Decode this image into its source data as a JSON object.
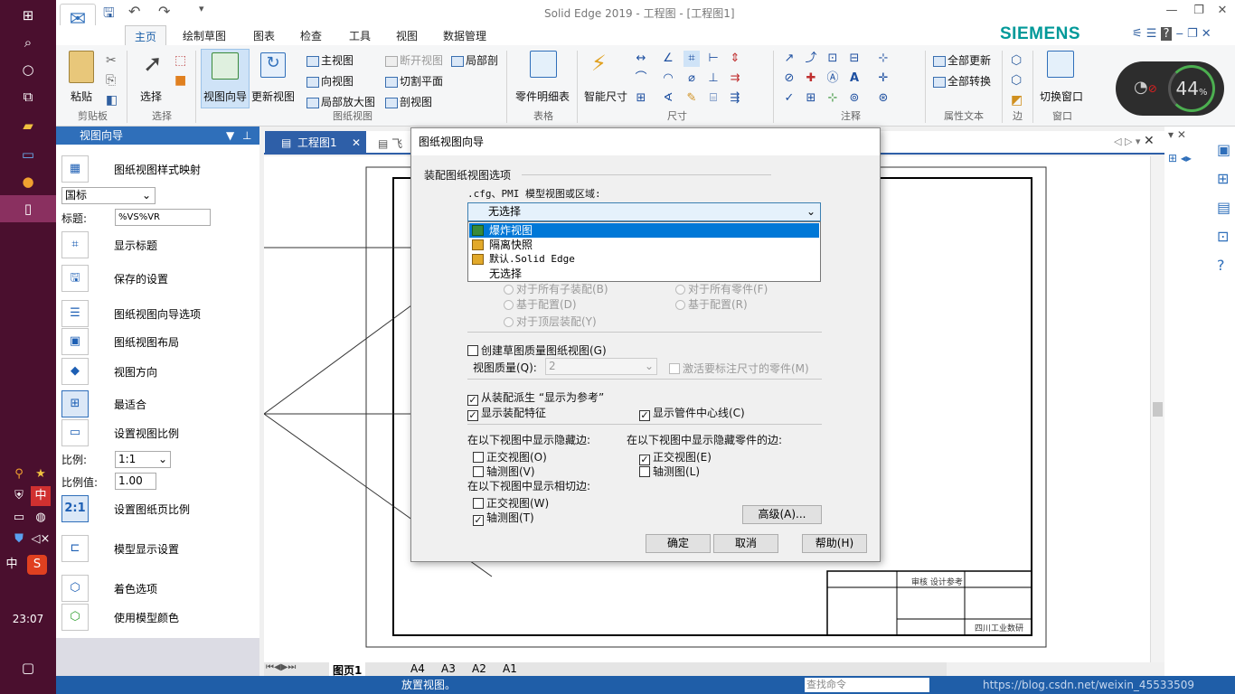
{
  "window": {
    "title": "Solid Edge 2019 - 工程图 - [工程图1]",
    "brand": "SIEMENS"
  },
  "ribbon_tabs": [
    "主页",
    "绘制草图",
    "图表",
    "检查",
    "工具",
    "视图",
    "数据管理"
  ],
  "ribbon": {
    "paste": "粘贴",
    "select": "选择",
    "view_wizard": "视图向导",
    "update_views": "更新视图",
    "main_view": "主视图",
    "direction_view": "向视图",
    "detail_view": "局部放大图",
    "broken_view": "断开视图",
    "cut_plane": "切割平面",
    "section_view": "剖视图",
    "partial_section": "局部剖",
    "parts_list": "零件明细表",
    "smart_dimension": "智能尺寸",
    "update_all": "全部更新",
    "convert_all": "全部转换",
    "switch_window": "切换窗口",
    "groups": [
      "剪贴板",
      "选择",
      "图纸视图",
      "表格",
      "尺寸",
      "注释",
      "属性文本",
      "边",
      "窗口"
    ]
  },
  "wifi_percent": "44",
  "left_panel": {
    "title": "视图向导",
    "rows": [
      "图纸视图样式映射",
      "显示标题",
      "保存的设置",
      "图纸视图向导选项",
      "图纸视图布局",
      "视图方向",
      "最适合",
      "设置视图比例",
      "设置图纸页比例",
      "模型显示设置",
      "着色选项",
      "使用模型颜色"
    ],
    "standard": "国标",
    "caption_label": "标题:",
    "caption_value": "%VS%VR",
    "scale_label": "比例:",
    "scale_value": "1:1",
    "scale_num_label": "比例值:",
    "scale_num_value": "1.00"
  },
  "doc_tabs": [
    "工程图1",
    "飞"
  ],
  "sheet_tabs": [
    "图页1",
    "A4",
    "A3",
    "A2",
    "A1"
  ],
  "status": {
    "message": "放置视图。",
    "command_placeholder": "查找命令",
    "watermark": "https://blog.csdn.net/weixin_45533509"
  },
  "taskbar": {
    "time": "23:07",
    "ime": "中"
  },
  "dialog": {
    "title": "图纸视图向导",
    "section": "装配图纸视图选项",
    "pmi_label": ".cfg、PMI 模型视图或区域:",
    "combo_value": "无选择",
    "dropdown_items": [
      "爆炸视图",
      "隔离快照",
      "默认.Solid Edge",
      "无选择"
    ],
    "radio_sub": "对于所有子装配(B)",
    "radio_parts": "对于所有零件(F)",
    "radio_config": "基于配置(D)",
    "radio_config_r": "基于配置(R)",
    "radio_top": "对于顶层装配(Y)",
    "create_quality": "创建草图质量图纸视图(G)",
    "view_quality_label": "视图质量(Q):",
    "view_quality_value": "2",
    "activate_parts": "激活要标注尺寸的零件(M)",
    "derive_ref": "从装配派生 “显示为参考”",
    "show_features": "显示装配特征",
    "show_centerline": "显示管件中心线(C)",
    "hidden_edges_title": "在以下视图中显示隐藏边:",
    "hidden_parts_title": "在以下视图中显示隐藏零件的边:",
    "tangent_title": "在以下视图中显示相切边:",
    "ortho_o": "正交视图(O)",
    "iso_v": "轴测图(V)",
    "ortho_e": "正交视图(E)",
    "iso_l": "轴测图(L)",
    "ortho_w": "正交视图(W)",
    "iso_t": "轴测图(T)",
    "advanced": "高级(A)...",
    "ok": "确定",
    "cancel": "取消",
    "help": "帮助(H)"
  },
  "title_block": {
    "company": "四川工业数研",
    "check": "审核 设计参考",
    "ref": "设计参考"
  }
}
